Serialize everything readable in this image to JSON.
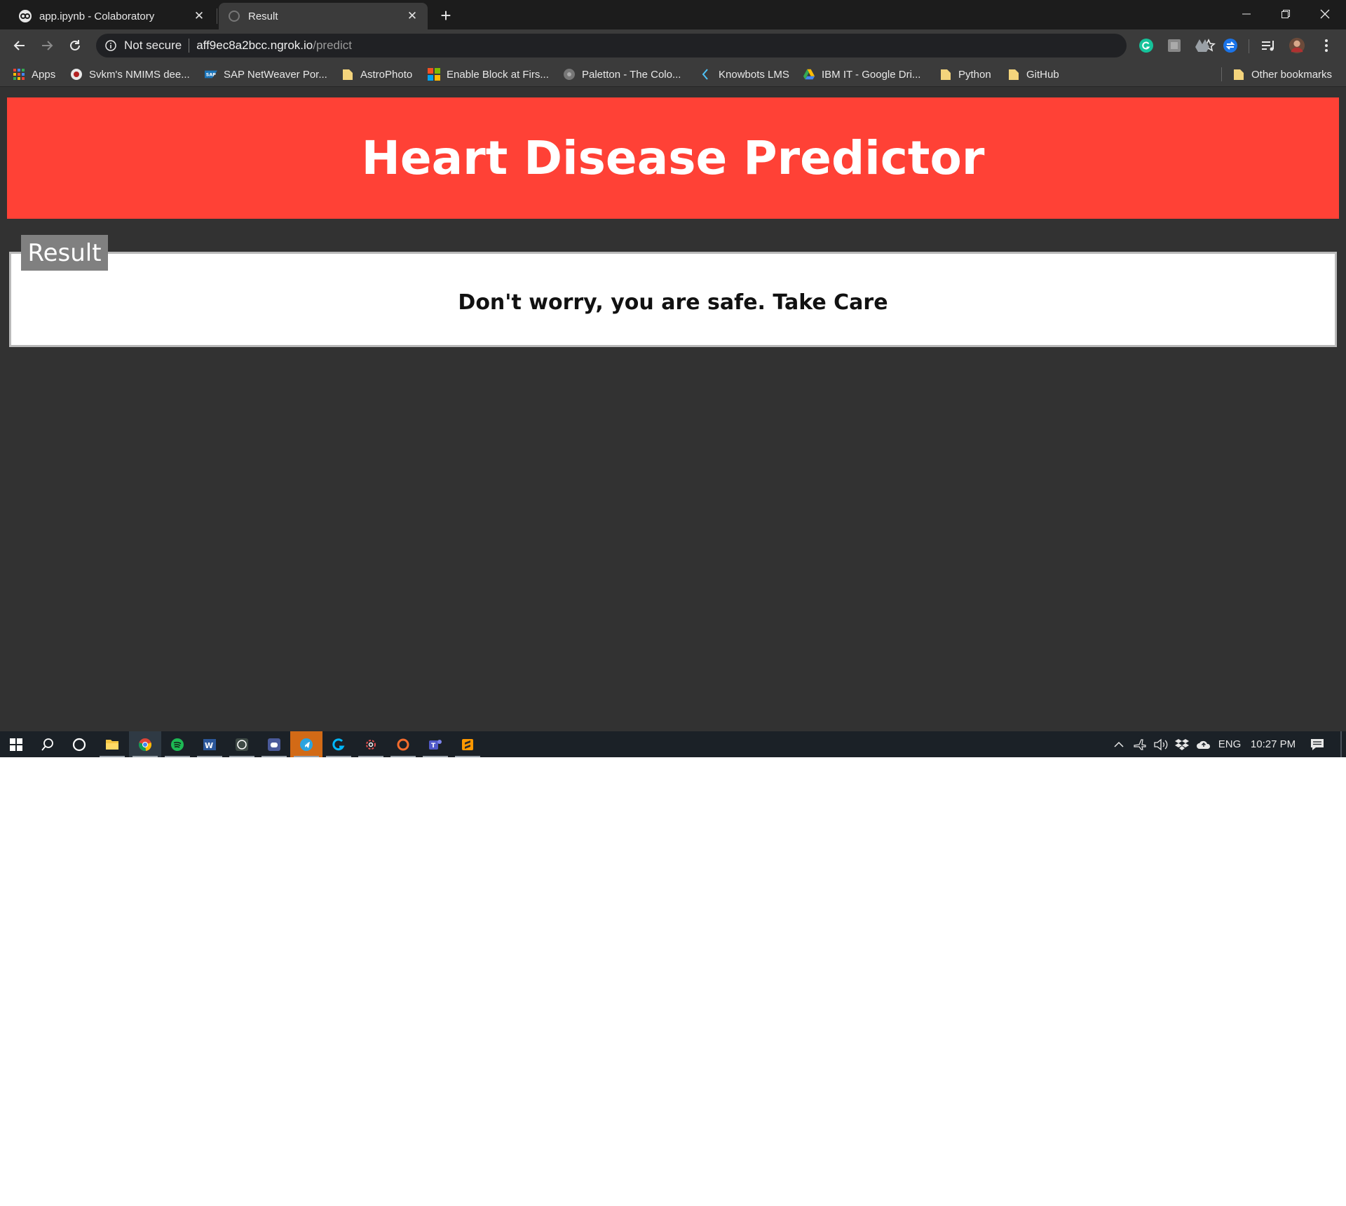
{
  "browser": {
    "tabs": [
      {
        "title": "app.ipynb - Colaboratory",
        "active": false
      },
      {
        "title": "Result",
        "active": true
      }
    ],
    "new_tab_label": "+",
    "omnibox": {
      "security_label": "Not secure",
      "url_host": "aff9ec8a2bcc.ngrok.io",
      "url_path": "/predict"
    },
    "bookmarks": [
      {
        "label": "Apps",
        "icon": "apps-grid-icon"
      },
      {
        "label": "Svkm's NMIMS dee...",
        "icon": "nmims-icon"
      },
      {
        "label": "SAP NetWeaver Por...",
        "icon": "sap-icon"
      },
      {
        "label": "AstroPhoto",
        "icon": "folder-icon"
      },
      {
        "label": "Enable Block at Firs...",
        "icon": "microsoft-icon"
      },
      {
        "label": "Paletton - The Colo...",
        "icon": "paletton-icon"
      },
      {
        "label": "Knowbots LMS",
        "icon": "knowbots-icon"
      },
      {
        "label": "IBM IT - Google Dri...",
        "icon": "google-drive-icon"
      },
      {
        "label": "Python",
        "icon": "folder-icon"
      },
      {
        "label": "GitHub",
        "icon": "folder-icon"
      }
    ],
    "other_bookmarks": "Other bookmarks"
  },
  "page": {
    "title": "Heart Disease Predictor",
    "result_legend": "Result",
    "result_message": "Don't worry, you are safe. Take Care",
    "colors": {
      "banner": "#ff4136",
      "background": "#323232",
      "legend": "#808080"
    }
  },
  "taskbar": {
    "apps": [
      "windows-start-icon",
      "search-icon",
      "cortana-icon",
      "file-explorer-icon",
      "chrome-icon",
      "spotify-icon",
      "word-icon",
      "whatsapp-icon",
      "discord-icon",
      "telegram-icon",
      "logitech-icon",
      "settings-gear-icon",
      "origin-icon",
      "teams-icon",
      "sublime-icon"
    ],
    "language": "ENG",
    "time": "10:27 PM"
  }
}
